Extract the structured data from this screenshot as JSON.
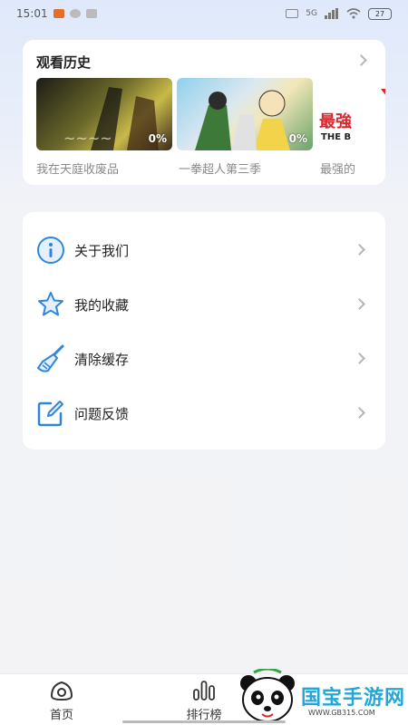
{
  "status_bar": {
    "time": "15:01",
    "signal": "5G",
    "battery": "27"
  },
  "history": {
    "title": "观看历史",
    "items": [
      {
        "title": "我在天庭收废品",
        "progress": "0%",
        "colors": [
          "#2b2a1f",
          "#6d6a2a",
          "#c9b94a"
        ]
      },
      {
        "title": "一拳超人第三季",
        "progress": "0%",
        "colors": [
          "#7fc6e6",
          "#e7e2c8",
          "#3d7a3a"
        ]
      },
      {
        "title": "最强的",
        "banner": "最強",
        "banner_sub": "THE B",
        "colors": [
          "#ffffff",
          "#d8282d"
        ]
      }
    ]
  },
  "menu": {
    "items": [
      {
        "label": "关于我们",
        "icon": "info-icon"
      },
      {
        "label": "我的收藏",
        "icon": "star-icon"
      },
      {
        "label": "清除缓存",
        "icon": "broom-icon"
      },
      {
        "label": "问题反馈",
        "icon": "edit-icon"
      }
    ]
  },
  "tab_bar": {
    "tabs": [
      {
        "label": "首页",
        "icon": "home-eye-icon"
      },
      {
        "label": "排行榜",
        "icon": "ranking-bars-icon"
      }
    ]
  },
  "watermark": {
    "text": "国宝手游网",
    "url": "WWW.GB315.COM"
  },
  "colors": {
    "accent": "#2f86de",
    "chevron": "#b5b5b5",
    "caption": "#8a8a8a",
    "watermark": "#23a7d9"
  }
}
